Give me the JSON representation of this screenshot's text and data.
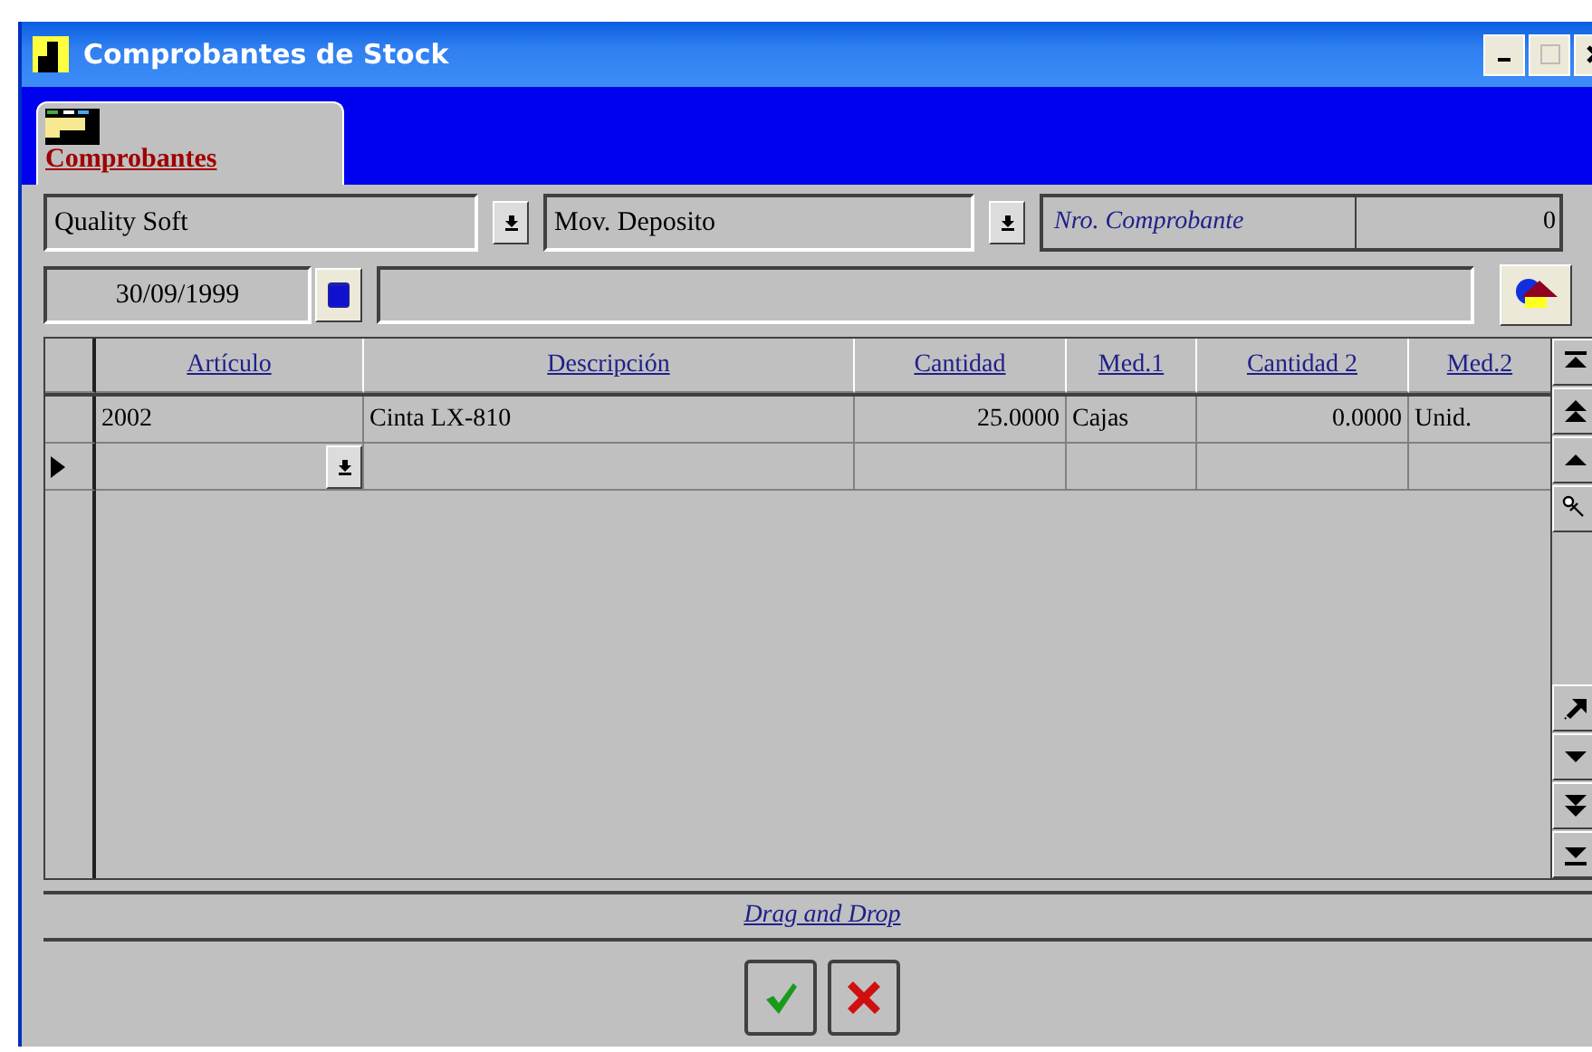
{
  "window": {
    "title": "Comprobantes de Stock"
  },
  "tabs": [
    {
      "label": "Comprobantes",
      "selected": true
    }
  ],
  "company": {
    "value": "Quality Soft"
  },
  "movement": {
    "value": "Mov. Deposito"
  },
  "voucher_number": {
    "label": "Nro. Comprobante",
    "value": "0"
  },
  "date": {
    "value": "30/09/1999"
  },
  "table": {
    "columns": [
      {
        "label": "Artículo",
        "kind": "text"
      },
      {
        "label": "Descripción",
        "kind": "text"
      },
      {
        "label": "Cantidad",
        "kind": "number"
      },
      {
        "label": "Med.1",
        "kind": "text"
      },
      {
        "label": "Cantidad 2",
        "kind": "number"
      },
      {
        "label": "Med.2",
        "kind": "text"
      }
    ],
    "rows": [
      {
        "cells": [
          "2002",
          "Cinta LX-810",
          "25.0000",
          "Cajas",
          "0.0000",
          "Unid."
        ],
        "current": false
      },
      {
        "current": true
      }
    ]
  },
  "footer": {
    "link": "Drag and Drop"
  },
  "buttons": [
    {
      "kind": "ok"
    },
    {
      "kind": "cancel"
    }
  ]
}
